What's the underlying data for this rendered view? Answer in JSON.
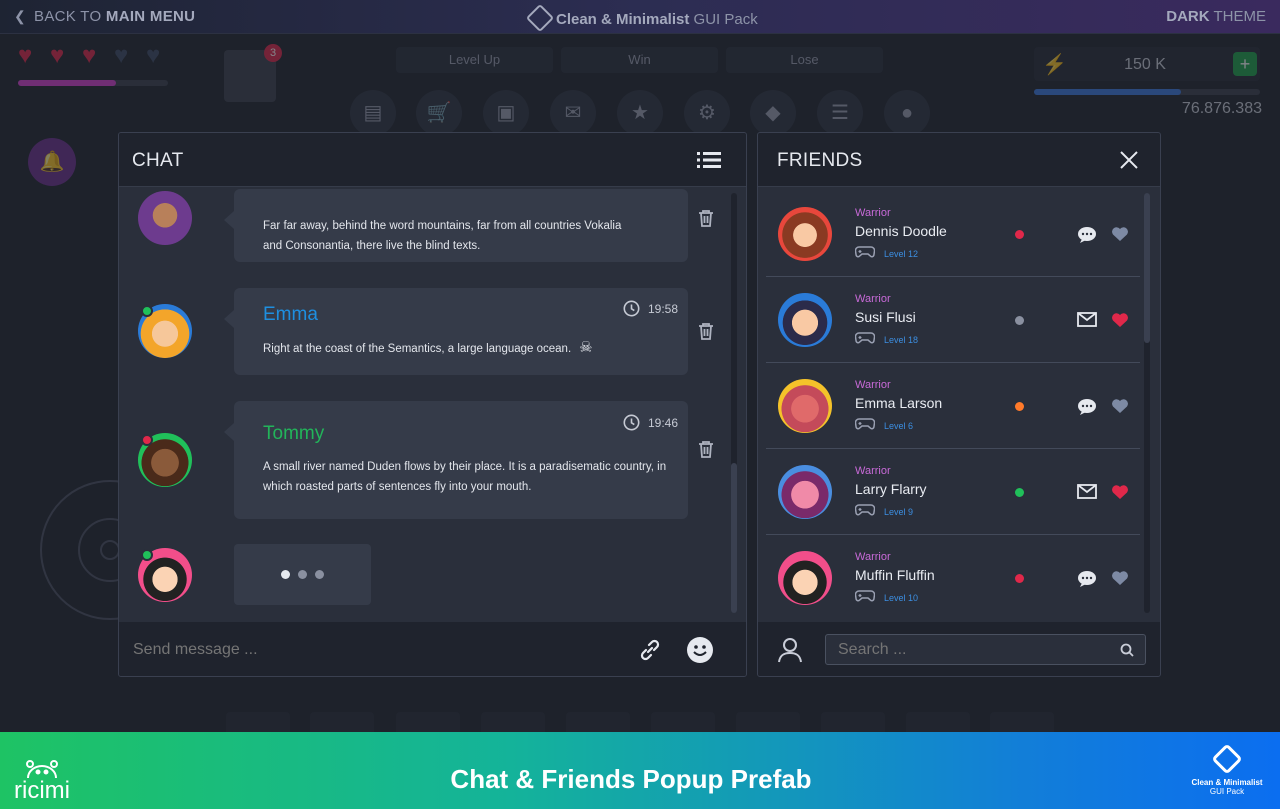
{
  "topbar": {
    "back_prefix": "BACK TO ",
    "back_bold": "MAIN MENU",
    "title_bold": "Clean & Minimalist",
    "title_rest": " GUI Pack",
    "theme_bold": "DARK",
    "theme_rest": " THEME"
  },
  "hud": {
    "notification_count": "3",
    "buttons": [
      "Level Up",
      "Win",
      "Lose"
    ],
    "currency": "150 K",
    "currency_add": "+",
    "score": "76.876.383",
    "health_fraction": 0.65,
    "energy_fraction": 0.65
  },
  "chat": {
    "title": "CHAT",
    "messages": [
      {
        "name": "",
        "time": "",
        "text": "Far far away, behind the word mountains, far from all countries Vokalia and Consonantia, there live the blind texts.",
        "name_color": "#1e8fe0"
      },
      {
        "name": "Emma",
        "time": "19:58",
        "text": "Right at the coast of the Semantics, a large language ocean.",
        "name_color": "#1e8fe0"
      },
      {
        "name": "Tommy",
        "time": "19:46",
        "text": "A small river named Duden flows by their place. It is a paradisematic country, in which roasted parts of sentences fly into your mouth.",
        "name_color": "#22b45a"
      }
    ],
    "input_placeholder": "Send message ..."
  },
  "friends": {
    "title": "FRIENDS",
    "items": [
      {
        "class": "Warrior",
        "name": "Dennis Doodle",
        "level": "Level 12",
        "status_color": "#e0284a",
        "action": "chat",
        "heart_color": "#7d8aa4"
      },
      {
        "class": "Warrior",
        "name": "Susi Flusi",
        "level": "Level 18",
        "status_color": "#8a90a0",
        "action": "mail",
        "heart_color": "#e0284a"
      },
      {
        "class": "Warrior",
        "name": "Emma Larson",
        "level": "Level 6",
        "status_color": "#ff7a2a",
        "action": "chat",
        "heart_color": "#7d8aa4"
      },
      {
        "class": "Warrior",
        "name": "Larry Flarry",
        "level": "Level 9",
        "status_color": "#20c05a",
        "action": "mail",
        "heart_color": "#e0284a"
      },
      {
        "class": "Warrior",
        "name": "Muffin Fluffin",
        "level": "Level 10",
        "status_color": "#e0284a",
        "action": "chat",
        "heart_color": "#7d8aa4"
      }
    ],
    "search_placeholder": "Search ..."
  },
  "banner": {
    "title": "Chat & Friends Popup Prefab",
    "brand": "ricimi",
    "pack_line1": "Clean & Minimalist",
    "pack_line2": "GUI Pack"
  },
  "colors": {
    "accent_blue": "#1e8fe0",
    "accent_green": "#22b45a",
    "warrior_purple": "#c86ad8",
    "heart_red": "#e0284a"
  }
}
